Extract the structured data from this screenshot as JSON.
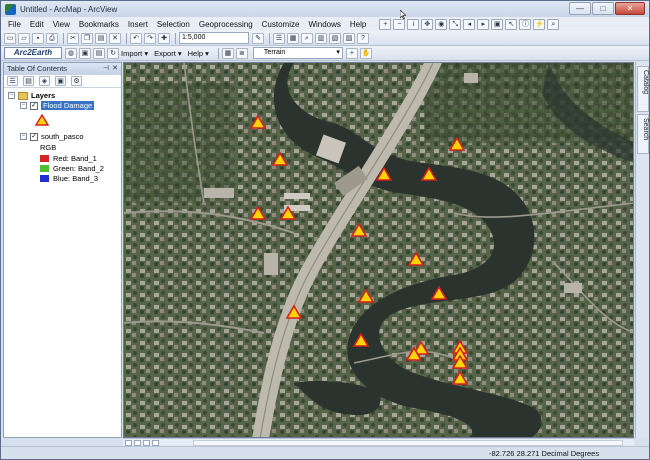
{
  "window": {
    "title": "Untitled - ArcMap - ArcView",
    "controls": [
      "—",
      "□",
      "✕"
    ]
  },
  "menu": [
    "File",
    "Edit",
    "View",
    "Bookmarks",
    "Insert",
    "Selection",
    "Geoprocessing",
    "Customize",
    "Windows",
    "Help"
  ],
  "toolbar": {
    "scale": "1:5,000",
    "arc2earth": "Arc2Earth",
    "import_label": "Import ▾",
    "export_label": "Export ▾",
    "help_label": "Help ▾",
    "basemap": "Terrain"
  },
  "toc": {
    "title": "Table Of Contents",
    "root": "Layers",
    "layers": [
      {
        "name": "Flood Damage",
        "checked": true,
        "selected": true
      },
      {
        "name": "south_pasco",
        "checked": true,
        "selected": false,
        "sublabel": "RGB"
      }
    ],
    "bands": [
      {
        "label": "Red:",
        "band": "Band_1",
        "color": "#d22626"
      },
      {
        "label": "Green:",
        "band": "Band_2",
        "color": "#4fbf2f"
      },
      {
        "label": "Blue:",
        "band": "Band_3",
        "color": "#1f2fd0"
      }
    ]
  },
  "dock": [
    "Catalog",
    "Search"
  ],
  "status": {
    "coordinates": "-82.726  28.271 Decimal Degrees"
  },
  "map": {
    "marker_symbol": "yellow-triangle-red-outline",
    "marker_color": "#ffd400",
    "marker_outline": "#d42020",
    "flood_damage_count": 19
  }
}
